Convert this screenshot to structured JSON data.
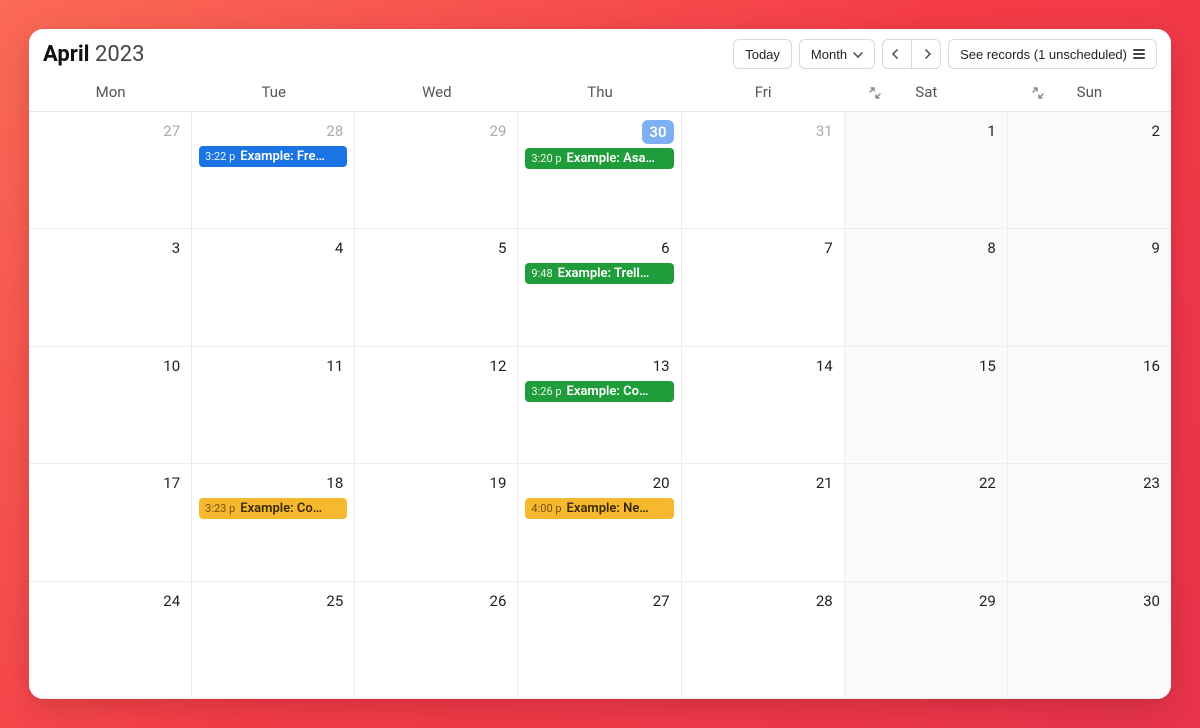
{
  "header": {
    "month": "April",
    "year": "2023",
    "today_label": "Today",
    "view_label": "Month",
    "records_label": "See records (1 unscheduled)"
  },
  "dow": [
    "Mon",
    "Tue",
    "Wed",
    "Thu",
    "Fri",
    "Sat",
    "Sun"
  ],
  "weeks": [
    [
      {
        "n": "27",
        "other": true
      },
      {
        "n": "28",
        "other": true,
        "events": [
          {
            "time": "3:22 p",
            "label": "Example: Fre…",
            "color": "blue"
          }
        ]
      },
      {
        "n": "29",
        "other": true
      },
      {
        "n": "30",
        "other": true,
        "today": true,
        "events": [
          {
            "time": "3:20 p",
            "label": "Example: Asa…",
            "color": "green"
          }
        ]
      },
      {
        "n": "31",
        "other": true
      },
      {
        "n": "1",
        "weekend": true
      },
      {
        "n": "2",
        "weekend": true
      }
    ],
    [
      {
        "n": "3"
      },
      {
        "n": "4"
      },
      {
        "n": "5"
      },
      {
        "n": "6",
        "events": [
          {
            "time": "9:48",
            "label": "Example: Trell…",
            "color": "green"
          }
        ]
      },
      {
        "n": "7"
      },
      {
        "n": "8",
        "weekend": true
      },
      {
        "n": "9",
        "weekend": true
      }
    ],
    [
      {
        "n": "10"
      },
      {
        "n": "11"
      },
      {
        "n": "12"
      },
      {
        "n": "13",
        "events": [
          {
            "time": "3:26 p",
            "label": "Example: Co…",
            "color": "green"
          }
        ]
      },
      {
        "n": "14"
      },
      {
        "n": "15",
        "weekend": true
      },
      {
        "n": "16",
        "weekend": true
      }
    ],
    [
      {
        "n": "17"
      },
      {
        "n": "18",
        "events": [
          {
            "time": "3:23 p",
            "label": "Example: Co…",
            "color": "orange"
          }
        ]
      },
      {
        "n": "19"
      },
      {
        "n": "20",
        "events": [
          {
            "time": "4:00 p",
            "label": "Example: Ne…",
            "color": "orange"
          }
        ]
      },
      {
        "n": "21"
      },
      {
        "n": "22",
        "weekend": true
      },
      {
        "n": "23",
        "weekend": true
      }
    ],
    [
      {
        "n": "24"
      },
      {
        "n": "25"
      },
      {
        "n": "26"
      },
      {
        "n": "27"
      },
      {
        "n": "28"
      },
      {
        "n": "29",
        "weekend": true
      },
      {
        "n": "30",
        "weekend": true
      }
    ]
  ],
  "colors": {
    "blue": "#1b74e4",
    "green": "#1f9d3a",
    "orange": "#f5b82e"
  }
}
